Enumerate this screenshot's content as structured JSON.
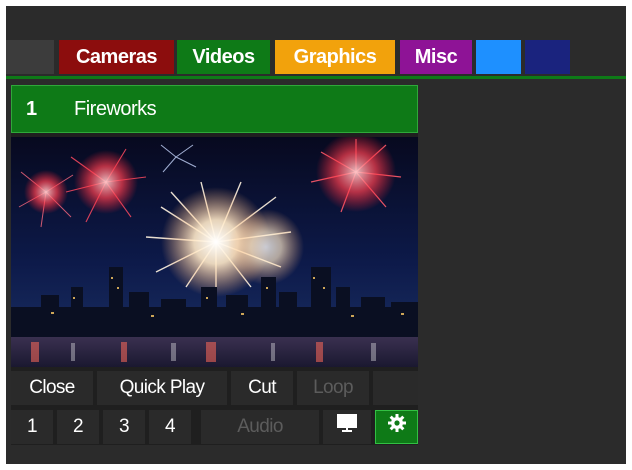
{
  "tabs": [
    {
      "label": "",
      "color": "#3c3c3c"
    },
    {
      "label": "Cameras",
      "color": "#8c0d0d"
    },
    {
      "label": "Videos",
      "color": "#0e7a17"
    },
    {
      "label": "Graphics",
      "color": "#f2a20c"
    },
    {
      "label": "Misc",
      "color": "#8e1396"
    },
    {
      "label": "",
      "color": "#1e90ff"
    },
    {
      "label": "",
      "color": "#1a237e"
    }
  ],
  "input": {
    "number": "1",
    "title": "Fireworks",
    "preview_icon": "fireworks-thumbnail"
  },
  "controls": {
    "close": "Close",
    "quick_play": "Quick Play",
    "cut": "Cut",
    "loop": "Loop"
  },
  "overlays": [
    "1",
    "2",
    "3",
    "4"
  ],
  "audio": "Audio",
  "icons": {
    "monitor": "monitor-icon",
    "settings": "gear-icon"
  },
  "colors": {
    "accent_green": "#0e7a17",
    "background": "#2b2b2b"
  }
}
